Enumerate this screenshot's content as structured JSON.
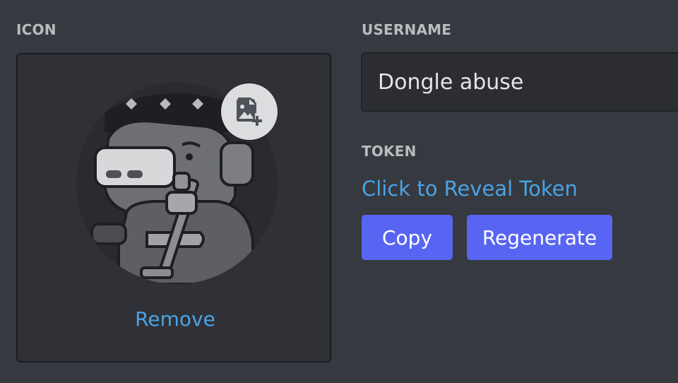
{
  "icon_section": {
    "label": "ICON",
    "remove_label": "Remove",
    "upload_icon": "image-plus-icon",
    "avatar_icon": "bot-avatar"
  },
  "username_section": {
    "label": "USERNAME",
    "value": "Dongle abuse"
  },
  "token_section": {
    "label": "TOKEN",
    "reveal_label": "Click to Reveal Token",
    "copy_label": "Copy",
    "regenerate_label": "Regenerate"
  },
  "colors": {
    "background": "#36393f",
    "panel": "#2f3136",
    "link": "#4aa3e5",
    "button": "#5865f2"
  }
}
